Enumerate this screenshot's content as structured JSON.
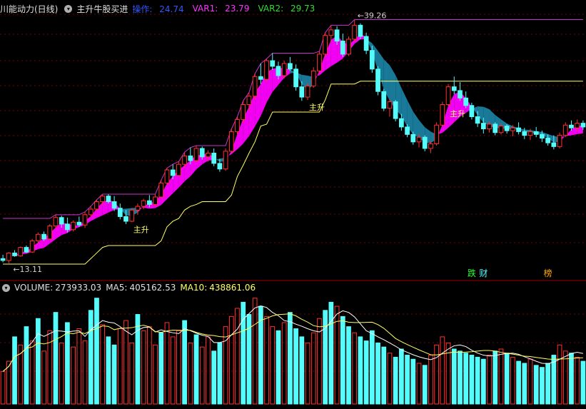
{
  "header": {
    "indicator_title": "川能动力(日线)",
    "formula_name": "主升牛股买进",
    "items": [
      {
        "label": "操作: ",
        "value": "24.74",
        "color": "#3355ff"
      },
      {
        "label": "VAR1: ",
        "value": "23.79",
        "color": "#ff33ff"
      },
      {
        "label": "VAR2: ",
        "value": "29.73",
        "color": "#33dd33"
      }
    ]
  },
  "volume_header": {
    "title": "VOLUME:",
    "value": "273933.03",
    "ma5_label": "MA5:",
    "ma5_value": "405162.53",
    "ma10_label": "MA10:",
    "ma10_value": "438861.06"
  },
  "colors": {
    "up": "#ff3030",
    "down": "#54fcfc",
    "band": "#ff00ff",
    "band_shadow": "#1a7fa0",
    "support": "#ffff66",
    "resistance": "#cc33cc",
    "grid": "#7a0000"
  },
  "chart_data": {
    "type": "candlestick",
    "price_range": [
      13.11,
      39.26
    ],
    "high_label": "39.26",
    "low_label": "13.11",
    "annotations": [
      "主升",
      "主升",
      "主升"
    ],
    "bottom_markers": [
      {
        "text": "跌",
        "color": "#33ff33"
      },
      {
        "text": "财",
        "color": "#54fcfc"
      },
      {
        "text": "榜",
        "color": "#ffaa00"
      }
    ],
    "candles": [
      [
        13.7,
        14.1,
        13.3,
        13.5
      ],
      [
        13.5,
        14.4,
        13.2,
        14.3
      ],
      [
        14.3,
        14.6,
        13.9,
        14.0
      ],
      [
        14.0,
        15.0,
        13.9,
        14.9
      ],
      [
        14.9,
        15.1,
        14.3,
        14.4
      ],
      [
        14.4,
        15.8,
        14.3,
        15.6
      ],
      [
        15.6,
        16.5,
        15.3,
        16.3
      ],
      [
        16.3,
        16.6,
        15.6,
        15.8
      ],
      [
        15.8,
        17.4,
        15.7,
        17.2
      ],
      [
        17.2,
        18.4,
        16.9,
        18.1
      ],
      [
        18.1,
        18.3,
        17.0,
        17.4
      ],
      [
        17.4,
        18.1,
        16.5,
        16.8
      ],
      [
        16.8,
        17.8,
        16.6,
        17.6
      ],
      [
        17.6,
        18.2,
        17.1,
        17.3
      ],
      [
        17.3,
        18.7,
        17.0,
        18.4
      ],
      [
        18.4,
        19.3,
        18.2,
        19.0
      ],
      [
        19.0,
        20.0,
        18.8,
        19.8
      ],
      [
        19.8,
        20.6,
        19.4,
        20.4
      ],
      [
        20.4,
        20.6,
        19.6,
        19.8
      ],
      [
        19.8,
        20.4,
        18.8,
        19.1
      ],
      [
        19.1,
        19.6,
        17.9,
        18.2
      ],
      [
        18.2,
        18.9,
        17.4,
        17.7
      ],
      [
        17.7,
        19.1,
        17.6,
        18.9
      ],
      [
        18.9,
        19.6,
        18.4,
        19.3
      ],
      [
        19.3,
        20.1,
        19.0,
        19.9
      ],
      [
        19.9,
        20.5,
        19.2,
        19.5
      ],
      [
        19.5,
        20.6,
        19.3,
        20.3
      ],
      [
        20.3,
        22.1,
        20.1,
        21.8
      ],
      [
        21.8,
        23.4,
        21.6,
        23.2
      ],
      [
        23.2,
        23.8,
        22.2,
        22.6
      ],
      [
        22.6,
        24.1,
        22.5,
        23.8
      ],
      [
        23.8,
        25.1,
        23.4,
        24.7
      ],
      [
        24.7,
        25.6,
        23.8,
        24.2
      ],
      [
        24.2,
        25.8,
        24.0,
        25.5
      ],
      [
        25.5,
        25.7,
        24.3,
        24.6
      ],
      [
        24.6,
        25.3,
        24.1,
        25.0
      ],
      [
        25.0,
        25.5,
        23.6,
        23.9
      ],
      [
        23.9,
        24.4,
        23.0,
        23.3
      ],
      [
        23.3,
        25.5,
        23.1,
        25.2
      ],
      [
        25.2,
        27.6,
        25.0,
        27.3
      ],
      [
        27.3,
        28.9,
        27.0,
        28.6
      ],
      [
        28.6,
        30.6,
        28.2,
        30.2
      ],
      [
        30.2,
        31.5,
        29.5,
        31.1
      ],
      [
        31.1,
        33.5,
        30.7,
        33.2
      ],
      [
        33.2,
        34.6,
        32.4,
        32.9
      ],
      [
        32.9,
        35.1,
        32.6,
        34.9
      ],
      [
        34.9,
        35.7,
        33.9,
        34.3
      ],
      [
        34.3,
        34.8,
        32.9,
        33.3
      ],
      [
        33.3,
        34.9,
        33.0,
        34.6
      ],
      [
        34.6,
        35.3,
        33.8,
        34.0
      ],
      [
        34.0,
        34.5,
        31.7,
        32.1
      ],
      [
        32.1,
        32.7,
        30.6,
        31.0
      ],
      [
        31.0,
        32.5,
        30.7,
        32.2
      ],
      [
        32.2,
        34.2,
        32.0,
        33.8
      ],
      [
        33.8,
        35.9,
        33.5,
        35.6
      ],
      [
        35.6,
        37.9,
        35.2,
        37.6
      ],
      [
        37.6,
        38.7,
        36.9,
        38.2
      ],
      [
        38.2,
        38.6,
        36.6,
        37.0
      ],
      [
        37.0,
        37.8,
        35.3,
        35.6
      ],
      [
        35.6,
        37.5,
        35.4,
        37.2
      ],
      [
        37.2,
        39.3,
        36.9,
        38.7
      ],
      [
        38.7,
        38.9,
        37.2,
        37.5
      ],
      [
        37.5,
        37.9,
        35.6,
        36.0
      ],
      [
        36.0,
        36.5,
        33.6,
        34.0
      ],
      [
        34.0,
        34.3,
        31.2,
        31.6
      ],
      [
        31.6,
        31.9,
        29.5,
        29.8
      ],
      [
        29.8,
        30.8,
        28.9,
        30.5
      ],
      [
        30.5,
        30.7,
        28.4,
        28.7
      ],
      [
        28.7,
        29.2,
        27.4,
        27.8
      ],
      [
        27.8,
        28.1,
        26.7,
        27.0
      ],
      [
        27.0,
        27.3,
        25.9,
        26.2
      ],
      [
        26.2,
        27.0,
        25.6,
        26.7
      ],
      [
        26.7,
        26.9,
        25.2,
        25.5
      ],
      [
        25.5,
        26.3,
        25.0,
        26.0
      ],
      [
        26.0,
        28.3,
        25.8,
        28.0
      ],
      [
        28.0,
        30.5,
        27.8,
        30.2
      ],
      [
        30.2,
        32.4,
        30.0,
        32.1
      ],
      [
        32.1,
        33.2,
        31.3,
        31.7
      ],
      [
        31.7,
        32.6,
        30.6,
        30.9
      ],
      [
        30.9,
        31.6,
        29.8,
        30.1
      ],
      [
        30.1,
        30.4,
        28.6,
        28.9
      ],
      [
        28.9,
        29.5,
        27.8,
        28.2
      ],
      [
        28.2,
        28.8,
        27.1,
        27.6
      ],
      [
        27.6,
        28.4,
        27.2,
        28.1
      ],
      [
        28.1,
        28.3,
        26.9,
        27.2
      ],
      [
        27.2,
        28.2,
        27.0,
        27.9
      ],
      [
        27.9,
        28.1,
        27.1,
        27.4
      ],
      [
        27.4,
        28.0,
        26.8,
        27.7
      ],
      [
        27.7,
        28.3,
        27.0,
        27.3
      ],
      [
        27.3,
        27.7,
        26.5,
        26.9
      ],
      [
        26.9,
        27.6,
        26.4,
        27.3
      ],
      [
        27.3,
        27.8,
        26.7,
        27.0
      ],
      [
        27.0,
        27.4,
        26.2,
        26.6
      ],
      [
        26.6,
        27.0,
        25.8,
        26.1
      ],
      [
        26.1,
        26.9,
        25.4,
        25.7
      ],
      [
        25.7,
        27.2,
        25.5,
        26.9
      ],
      [
        26.9,
        28.3,
        26.7,
        28.0
      ],
      [
        28.0,
        28.5,
        27.4,
        27.7
      ],
      [
        27.7,
        28.6,
        27.3,
        28.2
      ],
      [
        28.2,
        28.5,
        27.5,
        27.8
      ]
    ],
    "volume": [
      160,
      210,
      330,
      290,
      380,
      310,
      420,
      260,
      360,
      450,
      300,
      400,
      280,
      370,
      310,
      460,
      520,
      390,
      330,
      290,
      370,
      410,
      300,
      440,
      360,
      380,
      290,
      350,
      400,
      330,
      360,
      410,
      300,
      340,
      280,
      330,
      260,
      300,
      380,
      430,
      470,
      500,
      440,
      520,
      480,
      430,
      380,
      360,
      400,
      450,
      370,
      330,
      300,
      350,
      420,
      460,
      500,
      480,
      430,
      380,
      350,
      330,
      310,
      360,
      300,
      280,
      250,
      230,
      270,
      240,
      220,
      200,
      190,
      240,
      290,
      330,
      300,
      270,
      260,
      250,
      240,
      230,
      220,
      240,
      260,
      270,
      250,
      230,
      210,
      200,
      220,
      190,
      180,
      200,
      240,
      290,
      260,
      250,
      230,
      210
    ],
    "volume_down": [
      0,
      0,
      1,
      0,
      1,
      0,
      1,
      0,
      0,
      1,
      0,
      1,
      0,
      0,
      0,
      1,
      1,
      0,
      1,
      1,
      0,
      0,
      0,
      1,
      0,
      0,
      0,
      1,
      0,
      0,
      0,
      1,
      0,
      1,
      0,
      0,
      1,
      1,
      0,
      0,
      0,
      1,
      1,
      0,
      1,
      0,
      0,
      1,
      0,
      1,
      1,
      1,
      0,
      0,
      0,
      1,
      1,
      0,
      1,
      1,
      0,
      1,
      1,
      1,
      1,
      1,
      0,
      1,
      1,
      1,
      1,
      0,
      1,
      0,
      0,
      0,
      0,
      1,
      1,
      1,
      1,
      1,
      1,
      0,
      1,
      0,
      1,
      0,
      1,
      1,
      0,
      1,
      1,
      1,
      1,
      0,
      0,
      1,
      0,
      1
    ]
  }
}
